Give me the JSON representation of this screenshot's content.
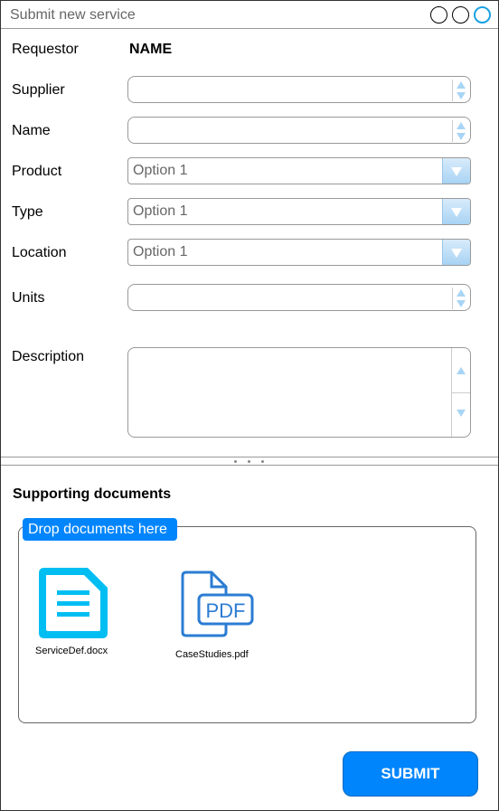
{
  "window": {
    "title": "Submit new service"
  },
  "form": {
    "requestor": {
      "label": "Requestor",
      "value": "NAME"
    },
    "supplier": {
      "label": "Supplier",
      "value": ""
    },
    "name": {
      "label": "Name",
      "value": ""
    },
    "product": {
      "label": "Product",
      "selected": "Option 1"
    },
    "type": {
      "label": "Type",
      "selected": "Option 1"
    },
    "location": {
      "label": "Location",
      "selected": "Option 1"
    },
    "units": {
      "label": "Units",
      "value": ""
    },
    "description": {
      "label": "Description",
      "value": ""
    }
  },
  "documents": {
    "title": "Supporting documents",
    "drop_label": "Drop documents here",
    "files": [
      {
        "name": "ServiceDef.docx",
        "icon": "document-icon"
      },
      {
        "name": "CaseStudies.pdf",
        "icon": "pdf-icon",
        "badge": "PDF"
      }
    ]
  },
  "actions": {
    "submit_label": "SUBMIT"
  },
  "colors": {
    "accent": "#0085fc",
    "doc_icon": "#00bef2",
    "pdf_icon": "#2b7cd3"
  }
}
